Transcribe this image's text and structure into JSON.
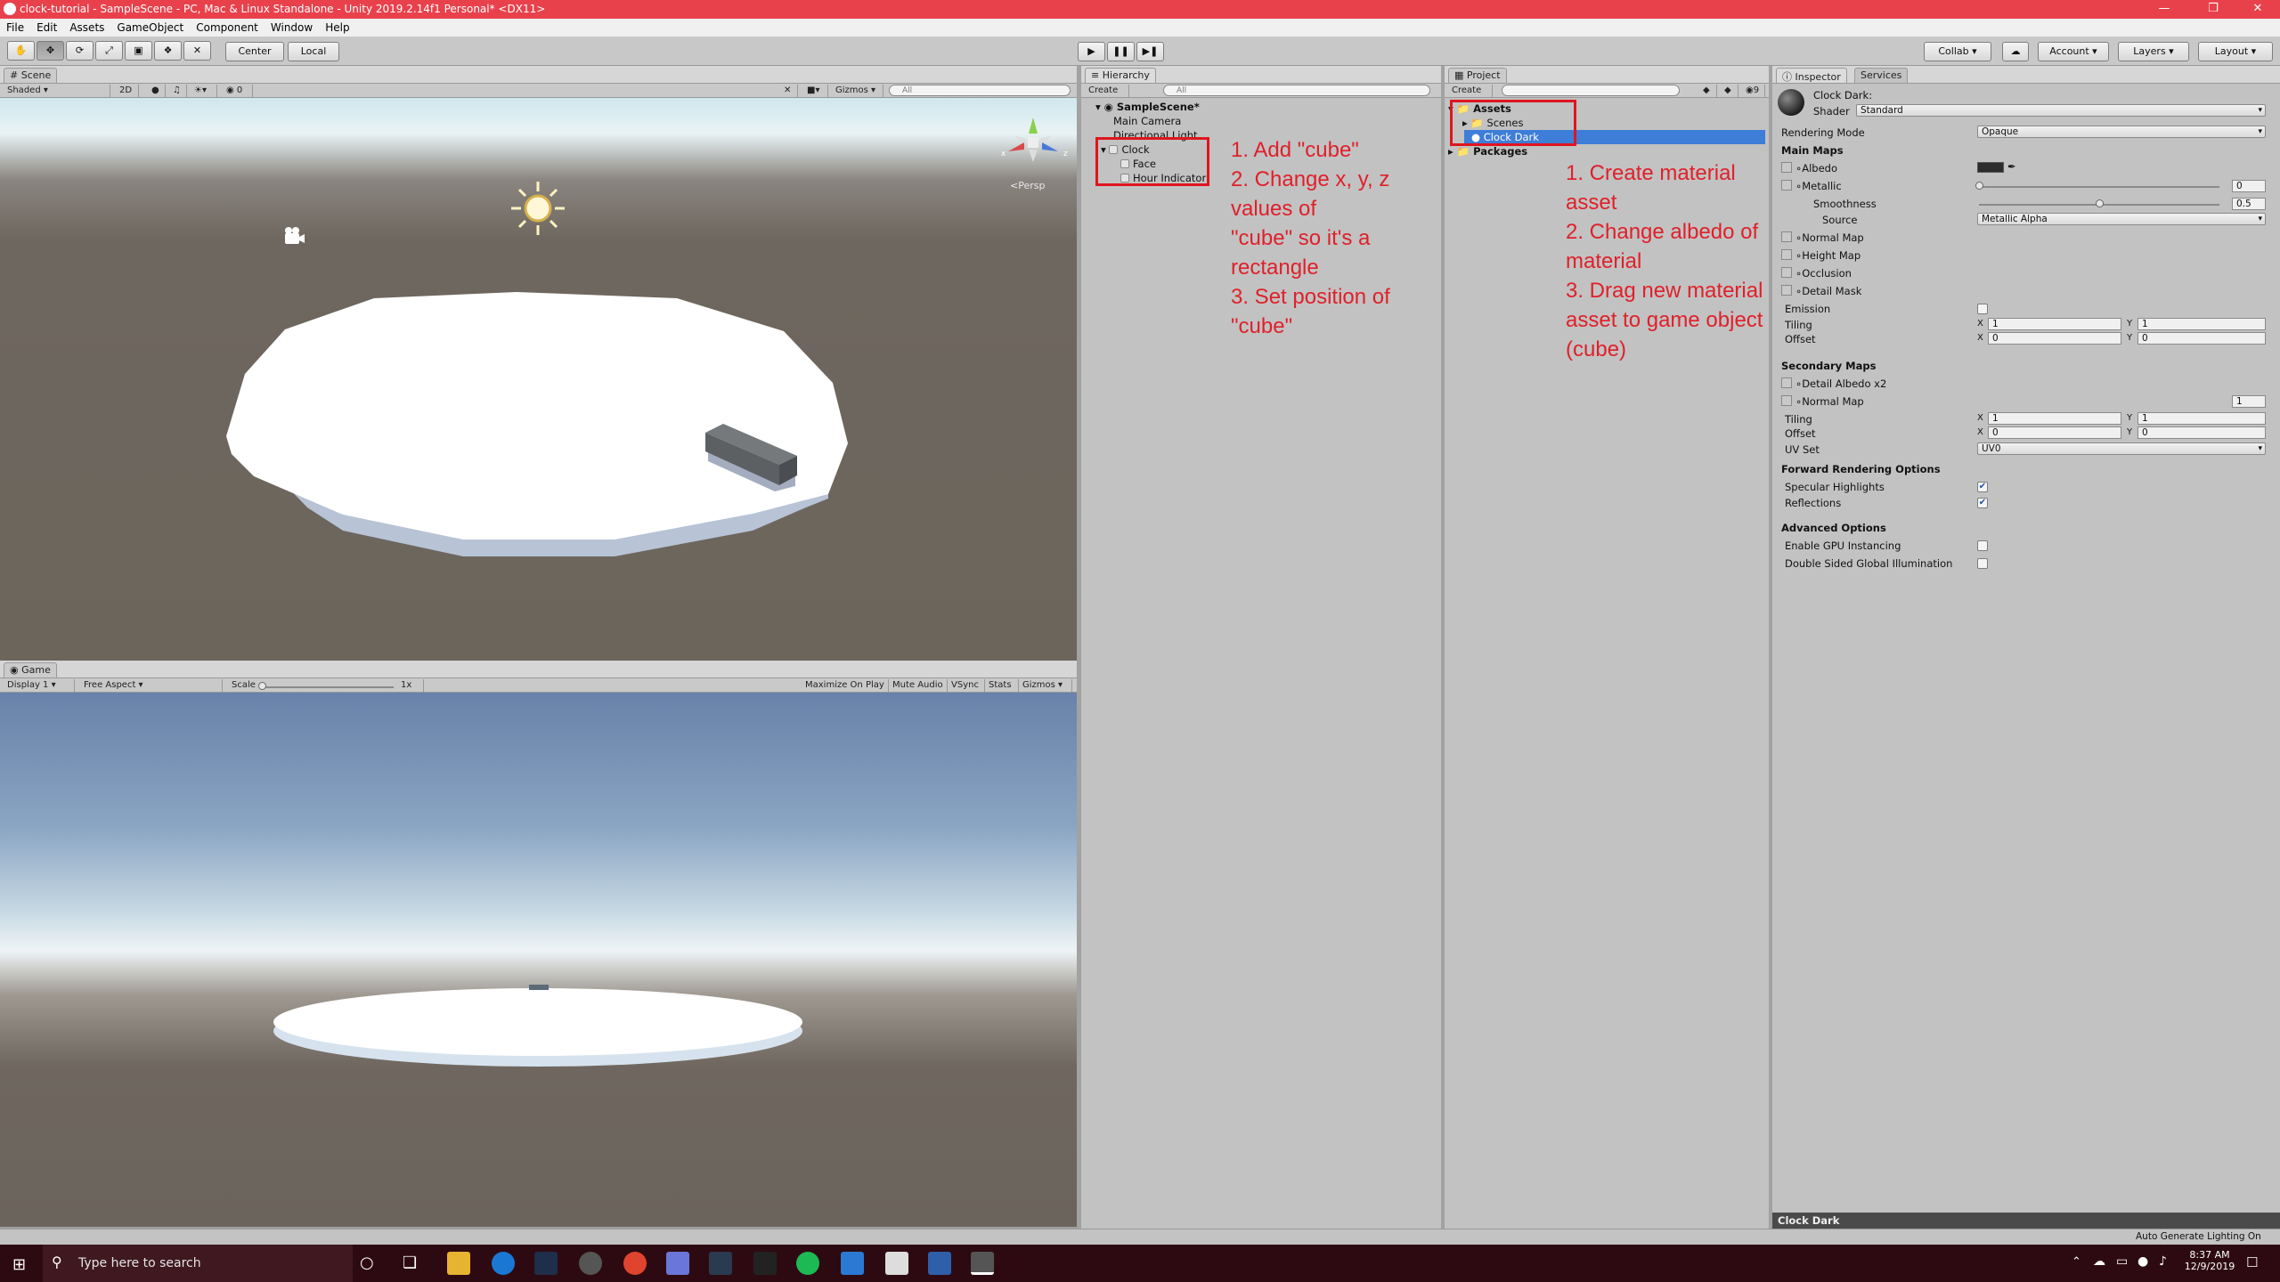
{
  "window": {
    "title": "clock-tutorial - SampleScene - PC, Mac & Linux Standalone - Unity 2019.2.14f1 Personal* <DX11>"
  },
  "menu": [
    "File",
    "Edit",
    "Assets",
    "GameObject",
    "Component",
    "Window",
    "Help"
  ],
  "toolbar": {
    "pivot_label": "Center",
    "space_label": "Local",
    "collab_label": "Collab",
    "account_label": "Account",
    "layers_label": "Layers",
    "layout_label": "Layout"
  },
  "scene": {
    "tab": "Scene",
    "shading": "Shaded",
    "mode_2d": "2D",
    "gizmos": "Gizmos",
    "search_placeholder": "All",
    "persp": "Persp",
    "hidden_count": "0"
  },
  "game": {
    "tab": "Game",
    "display": "Display 1",
    "aspect": "Free Aspect",
    "scale_label": "Scale",
    "scale_value": "1x",
    "maximize": "Maximize On Play",
    "mute": "Mute Audio",
    "vsync": "VSync",
    "stats": "Stats",
    "gizmos": "Gizmos"
  },
  "hierarchy": {
    "tab": "Hierarchy",
    "create": "Create",
    "search_placeholder": "All",
    "scene_name": "SampleScene*",
    "items": [
      "Main Camera",
      "Directional Light",
      "Clock",
      "Face",
      "Hour Indicator"
    ]
  },
  "project": {
    "tab": "Project",
    "create": "Create",
    "hidden_count": "9",
    "assets": "Assets",
    "scenes": "Scenes",
    "material": "Clock Dark",
    "packages": "Packages"
  },
  "inspector": {
    "tab": "Inspector",
    "services_tab": "Services",
    "object_name": "Clock Dark:",
    "shader_label": "Shader",
    "shader_value": "Standard",
    "rendering_mode_label": "Rendering Mode",
    "rendering_mode_value": "Opaque",
    "main_maps": "Main Maps",
    "albedo": "Albedo",
    "metallic": "Metallic",
    "metallic_value": "0",
    "smoothness": "Smoothness",
    "smoothness_value": "0.5",
    "source": "Source",
    "source_value": "Metallic Alpha",
    "normal_map": "Normal Map",
    "height_map": "Height Map",
    "occlusion": "Occlusion",
    "detail_mask": "Detail Mask",
    "emission": "Emission",
    "tiling": "Tiling",
    "offset": "Offset",
    "x": "X",
    "y": "Y",
    "tiling_x": "1",
    "tiling_y": "1",
    "offset_x": "0",
    "offset_y": "0",
    "secondary_maps": "Secondary Maps",
    "detail_albedo": "Detail Albedo x2",
    "sec_normal_map": "Normal Map",
    "sec_normal_value": "1",
    "sec_tiling_x": "1",
    "sec_tiling_y": "1",
    "sec_offset_x": "0",
    "sec_offset_y": "0",
    "uv_set": "UV Set",
    "uv_set_value": "UV0",
    "forward_options": "Forward Rendering Options",
    "specular": "Specular Highlights",
    "reflections": "Reflections",
    "advanced": "Advanced Options",
    "gpu_instancing": "Enable GPU Instancing",
    "double_sided": "Double Sided Global Illumination",
    "preview_name": "Clock Dark"
  },
  "status": {
    "auto_lighting": "Auto Generate Lighting On"
  },
  "annotations": {
    "hierarchy_notes": [
      "1. Add \"cube\"",
      "2. Change x, y, z values of",
      "\"cube\" so it's a rectangle",
      "3. Set position of \"cube\""
    ],
    "project_notes": [
      "1. Create material",
      "asset",
      "2. Change albedo of",
      "material",
      "3. Drag new material",
      "asset to game object",
      "(cube)"
    ]
  },
  "taskbar": {
    "search_placeholder": "Type here to search",
    "time": "8:37 AM",
    "date": "12/9/2019"
  },
  "colors": {
    "title_bar": "#e8414c",
    "annotation_red": "#e0202a",
    "selection_blue": "#3e7dd8"
  }
}
